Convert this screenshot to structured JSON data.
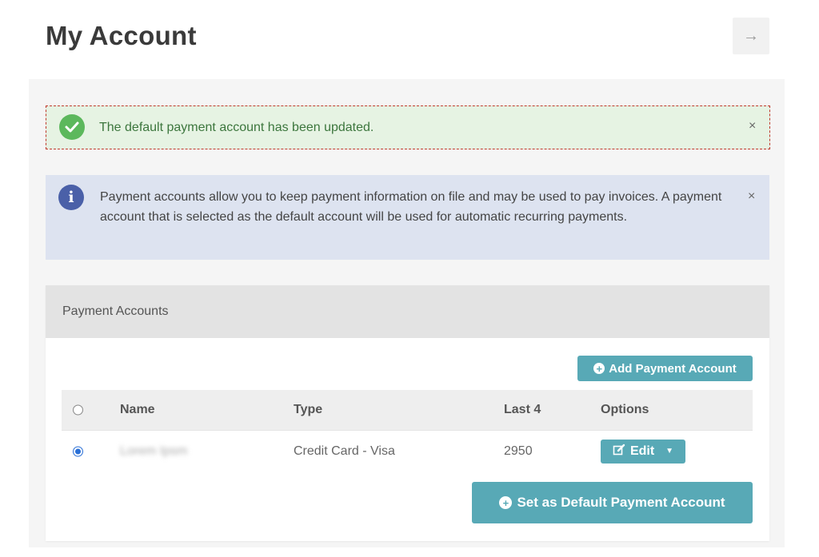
{
  "header": {
    "title": "My Account",
    "nav_icon": "→"
  },
  "alerts": {
    "success": {
      "message": "The default payment account has been updated.",
      "close": "×"
    },
    "info": {
      "message": "Payment accounts allow you to keep payment information on file and may be used to pay invoices. A payment account that is selected as the default account will be used for automatic recurring payments.",
      "close": "×"
    }
  },
  "card": {
    "title": "Payment Accounts",
    "add_button": "Add Payment Account",
    "table": {
      "headers": {
        "name": "Name",
        "type": "Type",
        "last4": "Last 4",
        "options": "Options"
      },
      "rows": [
        {
          "name": "Lorem Ipsm",
          "type": "Credit Card - Visa",
          "last4": "2950",
          "edit_label": "Edit",
          "selected": true
        }
      ]
    },
    "default_button": "Set as Default Payment Account"
  },
  "colors": {
    "accent": "#58a9b6",
    "success_bg": "#e6f3e3",
    "info_bg": "#dde3f0",
    "success_icon": "#5cb85c",
    "info_icon": "#4a60a8"
  }
}
